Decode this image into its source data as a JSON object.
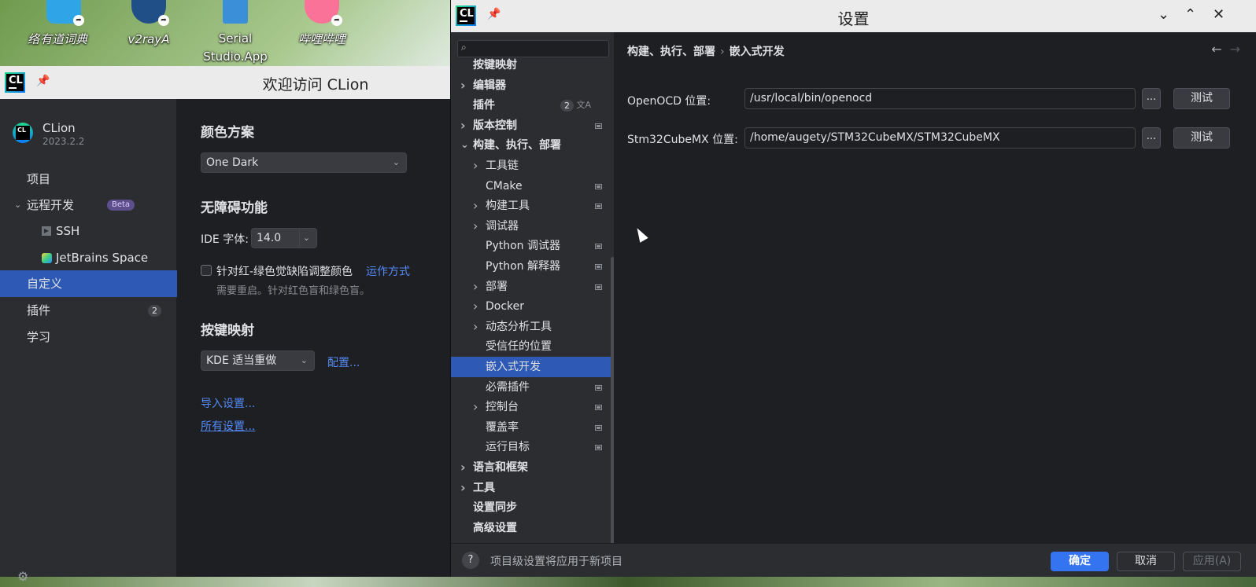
{
  "desktop": {
    "icons": [
      {
        "label": "络",
        "color": "#2e7de0"
      },
      {
        "label": "有道词典",
        "color": "#2fa4e7"
      },
      {
        "label": "v2rayA",
        "color": "#1f5f9e"
      },
      {
        "label": "Serial Studio.App",
        "color": "#3a8fd8"
      },
      {
        "label": "哔哩哔哩",
        "color": "#fb7299"
      }
    ]
  },
  "welcome": {
    "logo_text": "CL",
    "title": "欢迎访问 CLion",
    "app_name": "CLion",
    "app_version": "2023.2.2",
    "nav": {
      "projects": "项目",
      "remote_dev": "远程开发",
      "remote_dev_badge": "Beta",
      "ssh": "SSH",
      "jetbrains_space": "JetBrains Space",
      "customize": "自定义",
      "plugins": "插件",
      "plugins_count": "2",
      "learn": "学习"
    },
    "color_scheme": {
      "heading": "颜色方案",
      "value": "One Dark"
    },
    "accessibility": {
      "heading": "无障碍功能",
      "ide_font_label": "IDE 字体:",
      "ide_font_value": "14.0",
      "color_adjust_label": "针对红-绿色觉缺陷调整颜色",
      "how_it_works": "运作方式",
      "restart_note": "需要重启。针对红色盲和绿色盲。"
    },
    "keymap": {
      "heading": "按键映射",
      "value": "KDE 适当重做",
      "configure": "配置..."
    },
    "import_settings": "导入设置...",
    "all_settings": "所有设置..."
  },
  "settings": {
    "logo_text": "CL",
    "title": "设置",
    "search_placeholder": "",
    "tree": [
      {
        "label": "按键映射",
        "indent": 0,
        "arrow": false,
        "bold": true,
        "mark": false
      },
      {
        "label": "编辑器",
        "indent": 0,
        "arrow": "right",
        "bold": true,
        "mark": false
      },
      {
        "label": "插件",
        "indent": 0,
        "arrow": false,
        "bold": true,
        "mark": false,
        "badge": "2",
        "lang": true
      },
      {
        "label": "版本控制",
        "indent": 0,
        "arrow": "right",
        "bold": true,
        "mark": true
      },
      {
        "label": "构建、执行、部署",
        "indent": 0,
        "arrow": "down",
        "bold": true,
        "mark": false
      },
      {
        "label": "工具链",
        "indent": 1,
        "arrow": "right",
        "bold": false,
        "mark": false
      },
      {
        "label": "CMake",
        "indent": 1,
        "arrow": false,
        "bold": false,
        "mark": true
      },
      {
        "label": "构建工具",
        "indent": 1,
        "arrow": "right",
        "bold": false,
        "mark": true
      },
      {
        "label": "调试器",
        "indent": 1,
        "arrow": "right",
        "bold": false,
        "mark": false
      },
      {
        "label": "Python 调试器",
        "indent": 1,
        "arrow": false,
        "bold": false,
        "mark": true
      },
      {
        "label": "Python 解释器",
        "indent": 1,
        "arrow": false,
        "bold": false,
        "mark": true
      },
      {
        "label": "部署",
        "indent": 1,
        "arrow": "right",
        "bold": false,
        "mark": true
      },
      {
        "label": "Docker",
        "indent": 1,
        "arrow": "right",
        "bold": false,
        "mark": false
      },
      {
        "label": "动态分析工具",
        "indent": 1,
        "arrow": "right",
        "bold": false,
        "mark": false
      },
      {
        "label": "受信任的位置",
        "indent": 1,
        "arrow": false,
        "bold": false,
        "mark": false
      },
      {
        "label": "嵌入式开发",
        "indent": 1,
        "arrow": false,
        "bold": false,
        "mark": false,
        "selected": true
      },
      {
        "label": "必需插件",
        "indent": 1,
        "arrow": false,
        "bold": false,
        "mark": true
      },
      {
        "label": "控制台",
        "indent": 1,
        "arrow": "right",
        "bold": false,
        "mark": true
      },
      {
        "label": "覆盖率",
        "indent": 1,
        "arrow": false,
        "bold": false,
        "mark": true
      },
      {
        "label": "运行目标",
        "indent": 1,
        "arrow": false,
        "bold": false,
        "mark": true
      },
      {
        "label": "语言和框架",
        "indent": 0,
        "arrow": "right",
        "bold": true,
        "mark": false
      },
      {
        "label": "工具",
        "indent": 0,
        "arrow": "right",
        "bold": true,
        "mark": false
      },
      {
        "label": "设置同步",
        "indent": 0,
        "arrow": false,
        "bold": true,
        "mark": false
      },
      {
        "label": "高级设置",
        "indent": 0,
        "arrow": false,
        "bold": true,
        "mark": false
      }
    ],
    "breadcrumb": {
      "parent": "构建、执行、部署",
      "separator": "›",
      "current": "嵌入式开发"
    },
    "openocd": {
      "label": "OpenOCD 位置:",
      "value": "/usr/local/bin/openocd",
      "browse": "...",
      "test": "测试"
    },
    "stm32": {
      "label": "Stm32CubeMX 位置:",
      "value": "/home/augety/STM32CubeMX/STM32CubeMX",
      "browse": "...",
      "test": "测试"
    },
    "footer": {
      "help": "?",
      "note": "项目级设置将应用于新项目",
      "ok": "确定",
      "cancel": "取消",
      "apply": "应用(A)"
    }
  }
}
